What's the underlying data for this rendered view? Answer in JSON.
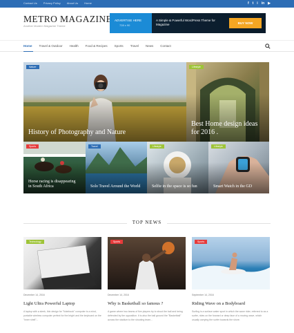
{
  "colors": {
    "brand": "#2d6db5",
    "accent_orange": "#f5a623",
    "cat_red": "#e63b3b",
    "cat_green": "#9ec438",
    "cat_blue": "#2d6db5"
  },
  "topbar": {
    "links": [
      "Contact Us",
      "Privacy Policy",
      "About Us",
      "Home"
    ],
    "social": [
      {
        "icon": "facebook-icon",
        "glyph": "f"
      },
      {
        "icon": "twitter-icon",
        "glyph": "t"
      },
      {
        "icon": "instagram-icon",
        "glyph": "i"
      },
      {
        "icon": "linkedin-icon",
        "glyph": "in"
      },
      {
        "icon": "youtube-icon",
        "glyph": "▶"
      }
    ]
  },
  "header": {
    "logo": "METRO MAGAZINE",
    "tagline": "Another Modern Magazine Theme"
  },
  "ad": {
    "advertise": "ADVERTISE HERE",
    "size": "728 x 90",
    "theme_text": "A Simple & Powerful WordPress Theme for Magazine",
    "buy": "BUY NOW"
  },
  "nav": {
    "items": [
      "Home",
      "Travel & Outdoor",
      "Health",
      "Food & Recipes",
      "Sports",
      "Travel",
      "News",
      "Contact"
    ],
    "active_index": 0,
    "search_icon": "search-icon"
  },
  "featured": {
    "main": {
      "category": "Nature",
      "title": "History of Photography and Nature"
    },
    "side": {
      "category": "Lifestyle",
      "title": "Best Home design ideas for 2016 ."
    },
    "small": [
      {
        "category": "Sports",
        "title": "Horse racing is disappearing in South Africa"
      },
      {
        "category": "Travel",
        "title": "Solo Travel Around the World"
      },
      {
        "category": "Lifestyle",
        "title": "Selfie in the space is so fun"
      },
      {
        "category": "Lifestyle",
        "title": "Smart Watch in the GD"
      }
    ]
  },
  "top_news": {
    "heading": "TOP NEWS",
    "cards": [
      {
        "category": "Technology",
        "date": "December 14, 2016",
        "title": "Light Ultra Powerful Laptop",
        "excerpt": "A laptop with a sleek, thin design for \"Notebook\" computer is a mind, portable wireless computer perfect for the bright and the keyboard on the \"inner shell\"..."
      },
      {
        "category": "Sports",
        "date": "December 14, 2016",
        "title": "Why is Basketball so famous ?",
        "excerpt": "A game where two teams of five players try to shoot the ball and being defended by the opposition. It is also the ball ground the \"Basketball\" across the stadium to the shooting team..."
      },
      {
        "category": "Sports",
        "date": "September 14, 2016",
        "title": "Riding Wave on a Bodyboard",
        "excerpt": "Surfing is a surface water sport in which the wave rider, referred to as a surfer, rides on the forward or deep face of a moving wave, which usually carrying the surfer towards the shore."
      }
    ]
  }
}
